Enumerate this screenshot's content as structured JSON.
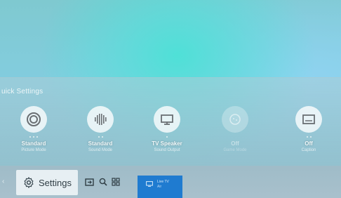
{
  "quick_settings": {
    "title": "uick Settings",
    "items": [
      {
        "value": "Standard",
        "label": "Picture Mode",
        "icon": "picture-mode-icon",
        "disabled": false
      },
      {
        "value": "Standard",
        "label": "Sound Mode",
        "icon": "sound-mode-icon",
        "disabled": false
      },
      {
        "value": "TV Speaker",
        "label": "Sound Output",
        "icon": "tv-speaker-icon",
        "disabled": false
      },
      {
        "value": "Off",
        "label": "Game Mode",
        "icon": "game-mode-icon",
        "disabled": true
      },
      {
        "value": "Off",
        "label": "Caption",
        "icon": "caption-icon",
        "disabled": false
      }
    ]
  },
  "home_bar": {
    "settings_label": "Settings",
    "live_tv": {
      "title": "Live TV",
      "subtitle": "Air"
    }
  },
  "colors": {
    "live_tv_tile": "#1f7bd0",
    "panel_overlay": "#9fbcc8"
  }
}
